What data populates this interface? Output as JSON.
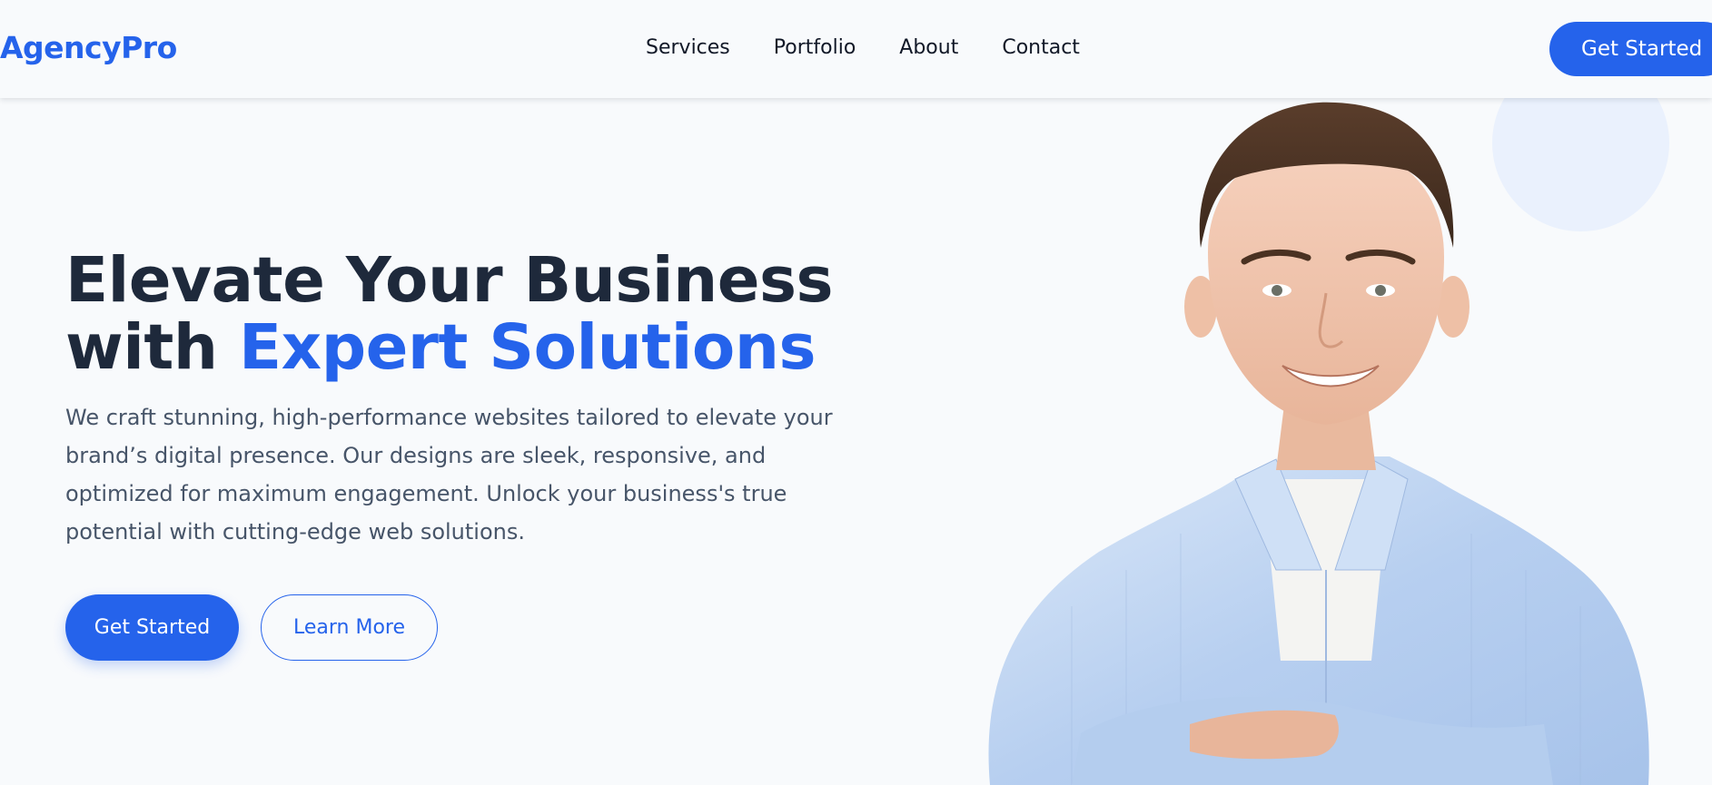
{
  "header": {
    "logo": "AgencyPro",
    "nav": [
      "Services",
      "Portfolio",
      "About",
      "Contact"
    ],
    "cta_label": "Get Started"
  },
  "hero": {
    "title_line1": "Elevate Your Business",
    "title_prefix": "with",
    "title_accent": "Expert Solutions",
    "description": "We craft stunning, high-performance websites tailored to elevate your brand’s digital presence. Our designs are sleek, responsive, and optimized for maximum engagement. Unlock your business's true potential with cutting-edge web solutions.",
    "primary_button": "Get Started",
    "secondary_button": "Learn More",
    "image_subject": "smiling man in light blue shirt with arms crossed"
  },
  "colors": {
    "accent": "#2563eb",
    "heading": "#1e293b",
    "body_text": "#475569",
    "background": "#f8fafc",
    "decor_circle": "#eaf1fd"
  }
}
